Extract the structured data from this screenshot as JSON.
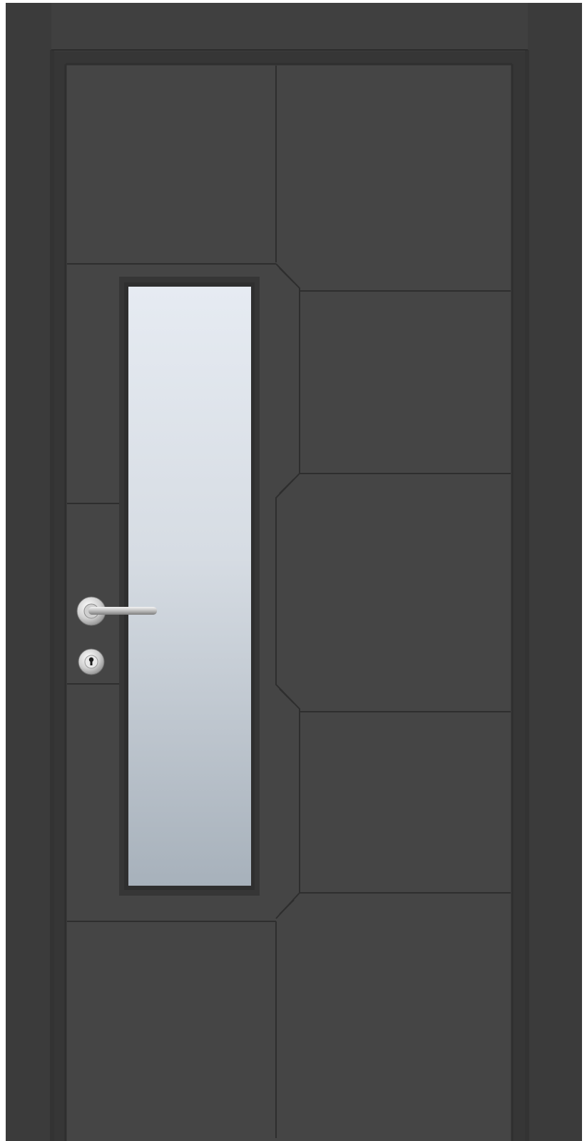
{
  "product": {
    "subject": "interior door",
    "finish_color": "#454545",
    "frame_color": "#3d3d3d",
    "groove_color": "#2e2e2e",
    "glass_top_color": "#e6ebf2",
    "glass_bottom_color": "#a7b1bb",
    "hardware_color": "#d9d9d9",
    "icons": [
      "door-handle-icon",
      "keyhole-icon"
    ]
  }
}
